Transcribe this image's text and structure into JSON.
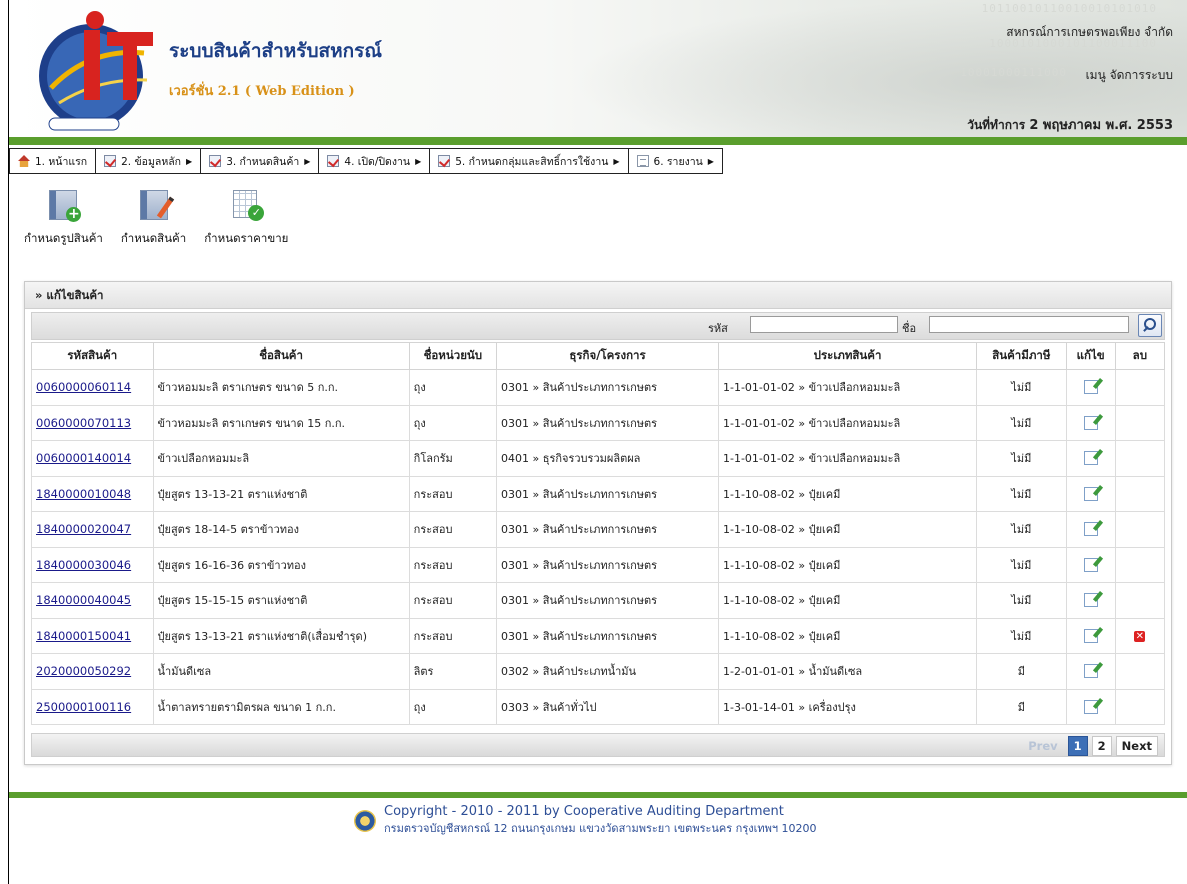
{
  "header": {
    "app_title": "ระบบสินค้าสำหรับสหกรณ์",
    "app_version": "เวอร์ชั่น 2.1 ( Web Edition )",
    "org_name": "สหกรณ์การเกษตรพอเพียง จำกัด",
    "admin_menu": "เมนู จัดการระบบ",
    "work_date_label": "วันที่ทำการ",
    "work_date": "2 พฤษภาคม พ.ศ. 2553",
    "binary_lines": [
      "10110010110010010101010",
      "1000101000101100011100",
      "10001000111000"
    ]
  },
  "menu": {
    "items": [
      {
        "label": "1. หน้าแรก",
        "icon": "home-icon",
        "caret": ""
      },
      {
        "label": "2. ข้อมูลหลัก",
        "icon": "checklist-icon",
        "caret": "▶"
      },
      {
        "label": "3. กำหนดสินค้า",
        "icon": "checklist-icon",
        "caret": "▶"
      },
      {
        "label": "4. เปิด/ปิดงาน",
        "icon": "checklist-icon",
        "caret": "▶"
      },
      {
        "label": "5. กำหนดกลุ่มและสิทธิ์การใช้งาน",
        "icon": "checklist-icon",
        "caret": "▶"
      },
      {
        "label": "6. รายงาน",
        "icon": "document-icon",
        "caret": "▶"
      }
    ]
  },
  "toolbar": {
    "product_group": "กำหนดรูปสินค้า",
    "product": "กำหนดสินค้า",
    "price": "กำหนดราคาขาย"
  },
  "panel": {
    "title": "» แก้ไขสินค้า",
    "search_code_label": "รหัส",
    "search_name_label": "ชื่อ",
    "search_code_value": "",
    "search_name_value": ""
  },
  "table": {
    "columns": [
      "รหัสสินค้า",
      "ชื่อสินค้า",
      "ชื่อหน่วยนับ",
      "ธุรกิจ/โครงการ",
      "ประเภทสินค้า",
      "สินค้ามีภาษี",
      "แก้ไข",
      "ลบ"
    ],
    "rows": [
      {
        "code": "0060000060114",
        "name": "ข้าวหอมมะลิ ตราเกษตร ขนาด 5 ก.ก.",
        "unit": "ถุง",
        "business": "0301 » สินค้าประเภทการเกษตร",
        "type": "1-1-01-01-02 » ข้าวเปลือกหอมมะลิ",
        "tax": "ไม่มี",
        "deletable": false
      },
      {
        "code": "0060000070113",
        "name": "ข้าวหอมมะลิ ตราเกษตร ขนาด 15 ก.ก.",
        "unit": "ถุง",
        "business": "0301 » สินค้าประเภทการเกษตร",
        "type": "1-1-01-01-02 » ข้าวเปลือกหอมมะลิ",
        "tax": "ไม่มี",
        "deletable": false
      },
      {
        "code": "0060000140014",
        "name": "ข้าวเปลือกหอมมะลิ",
        "unit": "กิโลกรัม",
        "business": "0401 » ธุรกิจรวบรวมผลิตผล",
        "type": "1-1-01-01-02 » ข้าวเปลือกหอมมะลิ",
        "tax": "ไม่มี",
        "deletable": false
      },
      {
        "code": "1840000010048",
        "name": "ปุ๋ยสูตร 13-13-21 ตราแห่งชาติ",
        "unit": "กระสอบ",
        "business": "0301 » สินค้าประเภทการเกษตร",
        "type": "1-1-10-08-02 » ปุ๋ยเคมี",
        "tax": "ไม่มี",
        "deletable": false
      },
      {
        "code": "1840000020047",
        "name": "ปุ๋ยสูตร 18-14-5 ตราข้าวทอง",
        "unit": "กระสอบ",
        "business": "0301 » สินค้าประเภทการเกษตร",
        "type": "1-1-10-08-02 » ปุ๋ยเคมี",
        "tax": "ไม่มี",
        "deletable": false
      },
      {
        "code": "1840000030046",
        "name": "ปุ๋ยสูตร 16-16-36 ตราข้าวทอง",
        "unit": "กระสอบ",
        "business": "0301 » สินค้าประเภทการเกษตร",
        "type": "1-1-10-08-02 » ปุ๋ยเคมี",
        "tax": "ไม่มี",
        "deletable": false
      },
      {
        "code": "1840000040045",
        "name": "ปุ๋ยสูตร 15-15-15 ตราแห่งชาติ",
        "unit": "กระสอบ",
        "business": "0301 » สินค้าประเภทการเกษตร",
        "type": "1-1-10-08-02 » ปุ๋ยเคมี",
        "tax": "ไม่มี",
        "deletable": false
      },
      {
        "code": "1840000150041",
        "name": "ปุ๋ยสูตร 13-13-21 ตราแห่งชาติ(เสื่อมชำรุด)",
        "unit": "กระสอบ",
        "business": "0301 » สินค้าประเภทการเกษตร",
        "type": "1-1-10-08-02 » ปุ๋ยเคมี",
        "tax": "ไม่มี",
        "deletable": true
      },
      {
        "code": "2020000050292",
        "name": "น้ำมันดีเซล",
        "unit": "ลิตร",
        "business": "0302 » สินค้าประเภทน้ำมัน",
        "type": "1-2-01-01-01 » น้ำมันดีเซล",
        "tax": "มี",
        "deletable": false
      },
      {
        "code": "2500000100116",
        "name": "น้ำตาลทรายตรามิตรผล ขนาด 1 ก.ก.",
        "unit": "ถุง",
        "business": "0303 » สินค้าทั่วไป",
        "type": "1-3-01-14-01 » เครื่องปรุง",
        "tax": "มี",
        "deletable": false
      }
    ]
  },
  "pager": {
    "prev": "Prev",
    "pages": [
      "1",
      "2"
    ],
    "current": "1",
    "next": "Next"
  },
  "footer": {
    "line1": "Copyright - 2010 - 2011  by Cooperative Auditing Department",
    "line2": "กรมตรวจบัญชีสหกรณ์ 12 ถนนกรุงเกษม แขวงวัดสามพระยา เขตพระนคร กรุงเทพฯ 10200"
  },
  "colors": {
    "accent_green": "#5a9e2d",
    "title_blue": "#1d3f86",
    "pager_active": "#3d6fb6"
  }
}
